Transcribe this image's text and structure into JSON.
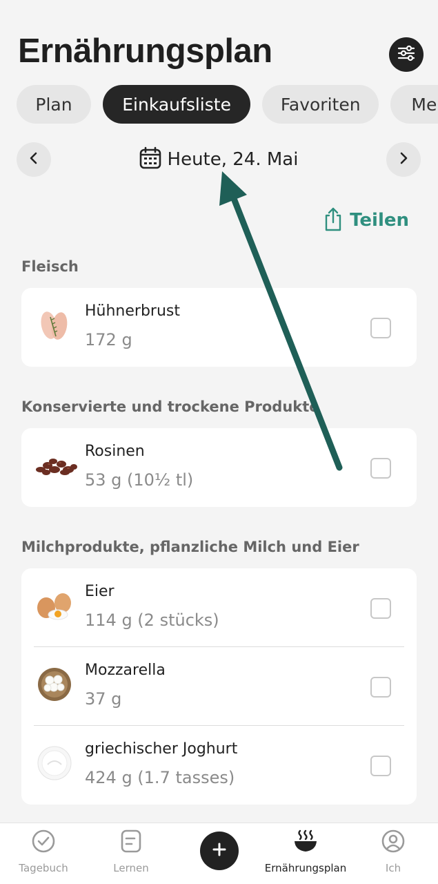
{
  "header": {
    "title": "Ernährungsplan",
    "settings_icon": "sliders-icon"
  },
  "tabs": [
    {
      "label": "Plan",
      "active": false
    },
    {
      "label": "Einkaufsliste",
      "active": true
    },
    {
      "label": "Favoriten",
      "active": false
    },
    {
      "label": "Mein",
      "active": false
    }
  ],
  "date_nav": {
    "label": "Heute, 24. Mai",
    "prev_icon": "chevron-left-icon",
    "next_icon": "chevron-right-icon",
    "calendar_icon": "calendar-icon"
  },
  "share": {
    "label": "Teilen",
    "icon": "share-icon"
  },
  "sections": [
    {
      "title": "Fleisch",
      "items": [
        {
          "name": "Hühnerbrust",
          "qty": "172 g",
          "checked": false
        }
      ]
    },
    {
      "title": "Konservierte und trockene Produkte",
      "items": [
        {
          "name": "Rosinen",
          "qty": "53 g (10½ tl)",
          "checked": false
        }
      ]
    },
    {
      "title": "Milchprodukte, pflanzliche Milch und Eier",
      "items": [
        {
          "name": "Eier",
          "qty": "114 g (2 stücks)",
          "checked": false
        },
        {
          "name": "Mozzarella",
          "qty": "37 g",
          "checked": false
        },
        {
          "name": "griechischer Joghurt",
          "qty": "424 g (1.7 tasses)",
          "checked": false
        }
      ]
    }
  ],
  "bottom_nav": {
    "items": [
      {
        "label": "Tagebuch",
        "icon": "check-circle-icon",
        "active": false
      },
      {
        "label": "Lernen",
        "icon": "document-icon",
        "active": false
      },
      {
        "label": "Ernährungsplan",
        "icon": "bowl-icon",
        "active": true
      },
      {
        "label": "Ich",
        "icon": "profile-icon",
        "active": false
      }
    ],
    "add_icon": "plus-icon"
  },
  "colors": {
    "accent": "#2f8f7f",
    "annotation_arrow": "#1f5f57",
    "active_tab": "#262626"
  }
}
